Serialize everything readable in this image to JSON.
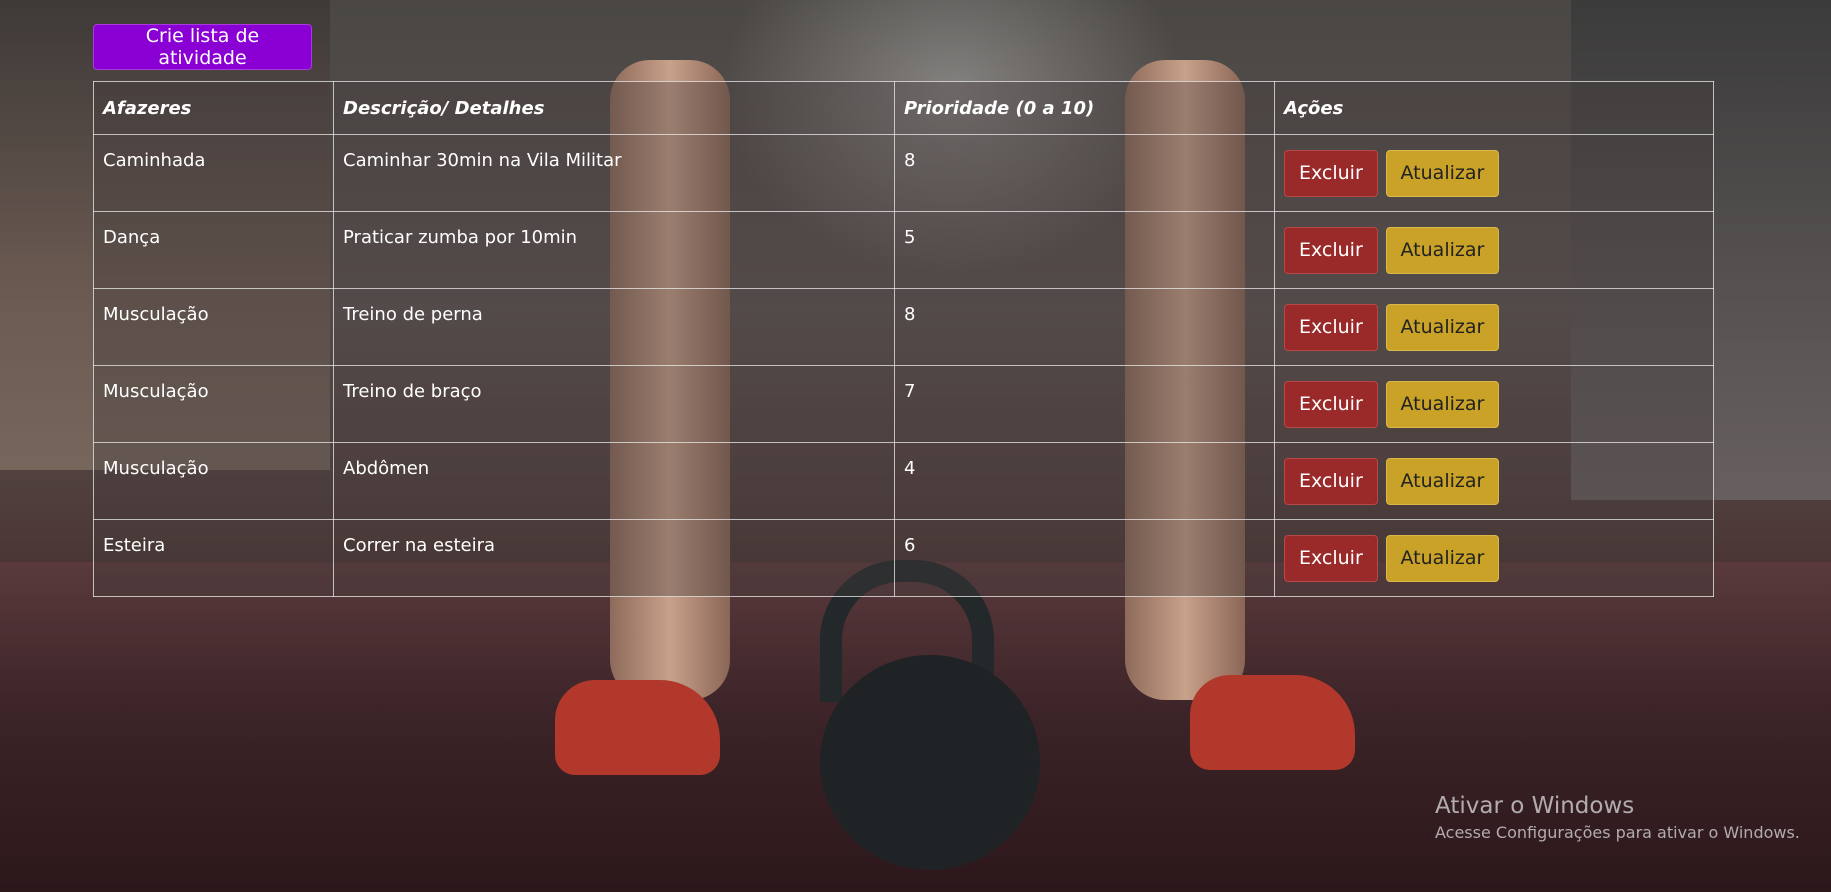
{
  "header": {
    "create_button_label": "Crie lista de atividade"
  },
  "table": {
    "headers": [
      "Afazeres",
      "Descrição/ Detalhes",
      "Prioridade (0 a 10)",
      "Ações"
    ],
    "rows": [
      {
        "task": "Caminhada",
        "details": "Caminhar 30min na Vila Militar",
        "priority": "8"
      },
      {
        "task": "Dança",
        "details": "Praticar zumba por 10min",
        "priority": "5"
      },
      {
        "task": "Musculação",
        "details": "Treino de perna",
        "priority": "8"
      },
      {
        "task": "Musculação",
        "details": "Treino de braço",
        "priority": "7"
      },
      {
        "task": "Musculação",
        "details": "Abdômen",
        "priority": "4"
      },
      {
        "task": "Esteira",
        "details": "Correr na esteira",
        "priority": "6"
      }
    ],
    "delete_label": "Excluir",
    "update_label": "Atualizar"
  },
  "watermark": {
    "title": "Ativar o Windows",
    "subtitle": "Acesse Configurações para ativar o Windows."
  },
  "colors": {
    "create_button": "#8a00d4",
    "delete_button": "#9a2a2a",
    "update_button": "#c9a227"
  }
}
